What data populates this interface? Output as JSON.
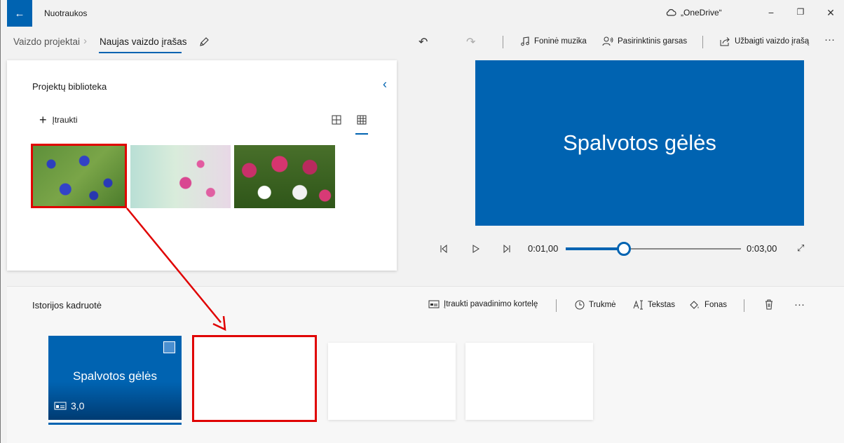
{
  "titlebar": {
    "back_icon": "←",
    "app_title": "Nuotraukos",
    "onedrive_label": "„OneDrive“",
    "minimize": "−",
    "maximize": "❐",
    "close": "✕"
  },
  "toolbar": {
    "breadcrumb_root": "Vaizdo projektai",
    "breadcrumb_sep": "›",
    "breadcrumb_current": "Naujas vaizdo įrašas",
    "undo_icon": "↶",
    "redo_icon": "↷",
    "background_music": "Foninė muzika",
    "custom_audio": "Pasirinktinis garsas",
    "finish_video": "Užbaigti vaizdo įrašą",
    "more": "···"
  },
  "library": {
    "title": "Projektų biblioteka",
    "add_label": "Įtraukti",
    "collapse_icon": "‹"
  },
  "preview": {
    "title_text": "Spalvotos gėlės",
    "current_time": "0:01,00",
    "total_time": "0:03,00",
    "progress": 0.33,
    "fullscreen_icon": "⤢"
  },
  "storyboard": {
    "title": "Istorijos kadruotė",
    "add_title_card": "Įtraukti pavadinimo kortelę",
    "duration": "Trukmė",
    "text": "Tekstas",
    "background": "Fonas",
    "more": "···",
    "card_title": "Spalvotos gėlės",
    "card_duration": "3,0"
  },
  "colors": {
    "accent": "#0063b1",
    "highlight": "#e00000"
  }
}
